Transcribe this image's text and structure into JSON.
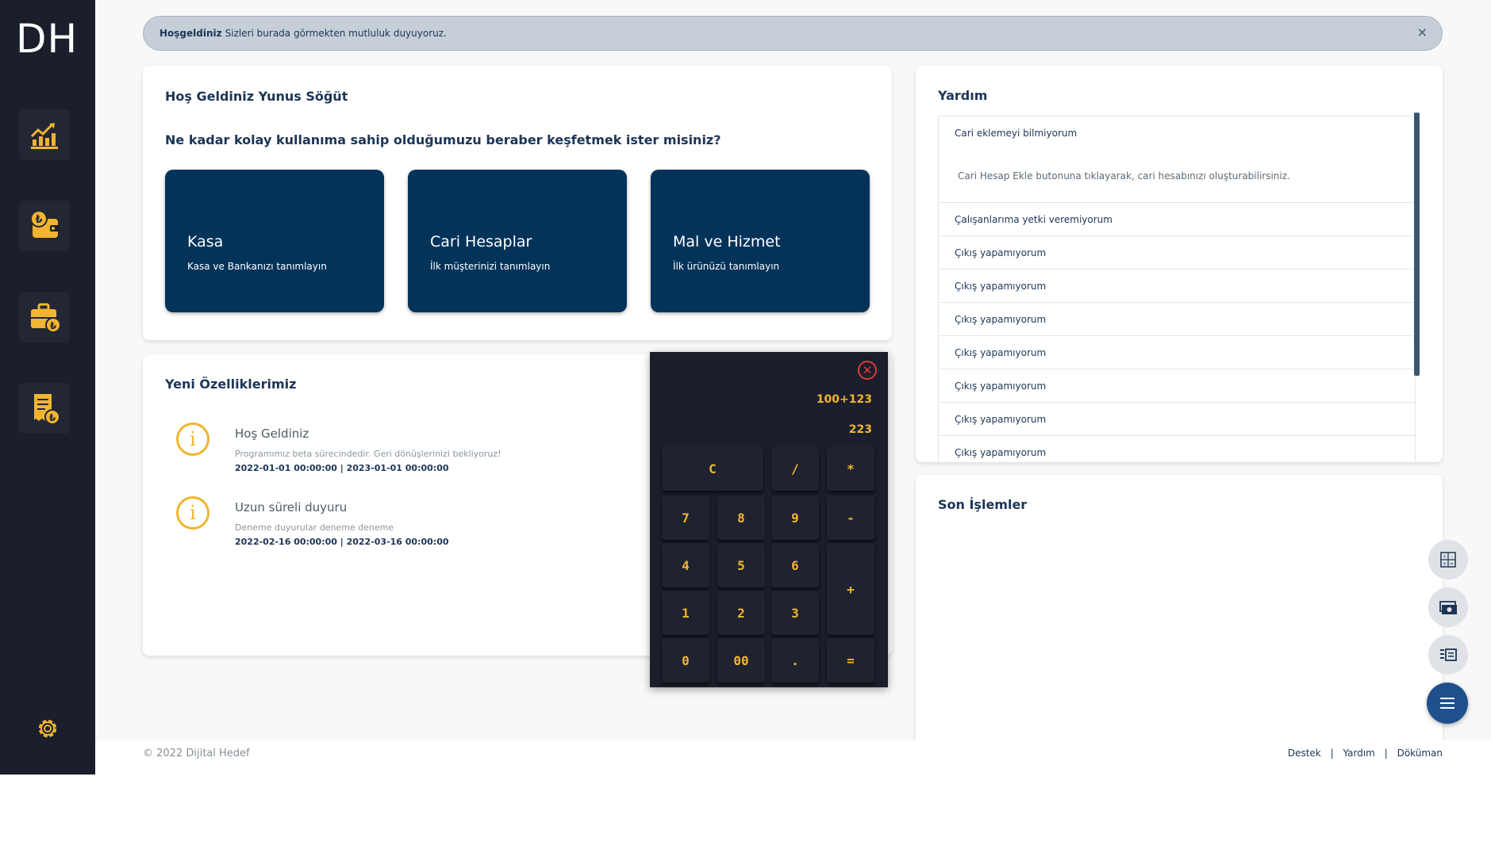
{
  "logo": "DH",
  "sidebar": {
    "items": [
      {
        "icon": "bar-chart-icon"
      },
      {
        "icon": "wallet-lira-icon"
      },
      {
        "icon": "briefcase-lira-icon"
      },
      {
        "icon": "receipt-lira-icon"
      }
    ],
    "settings_icon": "gear-icon"
  },
  "alert": {
    "strong": "Hoşgeldiniz",
    "text": "Sizleri burada görmekten mutluluk duyuyoruz.",
    "close": "×"
  },
  "welcome": {
    "title": "Hoş Geldiniz Yunus Söğüt",
    "question": "Ne kadar kolay kullanıma sahip olduğumuzu beraber keşfetmek ister misiniz?",
    "tiles": [
      {
        "title": "Kasa",
        "subtitle": "Kasa ve Bankanızı tanımlayın"
      },
      {
        "title": "Cari Hesaplar",
        "subtitle": "İlk müşterinizi tanımlayın"
      },
      {
        "title": "Mal ve Hizmet",
        "subtitle": "İlk ürünüzü tanımlayın"
      }
    ]
  },
  "features": {
    "title": "Yeni Özelliklerimiz",
    "items": [
      {
        "title": "Hoş Geldiniz",
        "desc": "Programımız beta sürecindedir. Geri dönüşlerinizi bekliyoruz!",
        "date": "2022-01-01 00:00:00 | 2023-01-01 00:00:00"
      },
      {
        "title": "Uzun süreli duyuru",
        "desc": "Deneme duyurular deneme deneme",
        "date": "2022-02-16 00:00:00 | 2022-03-16 00:00:00"
      }
    ]
  },
  "help": {
    "title": "Yardım",
    "items": [
      {
        "q": "Cari eklemeyi bilmiyorum",
        "a": "Cari Hesap Ekle butonuna tıklayarak, cari hesabınızı oluşturabilirsiniz."
      },
      {
        "q": "Çalışanlarıma yetki veremiyorum"
      },
      {
        "q": "Çıkış yapamıyorum"
      },
      {
        "q": "Çıkış yapamıyorum"
      },
      {
        "q": "Çıkış yapamıyorum"
      },
      {
        "q": "Çıkış yapamıyorum"
      },
      {
        "q": "Çıkış yapamıyorum"
      },
      {
        "q": "Çıkış yapamıyorum"
      },
      {
        "q": "Çıkış yapamıyorum"
      }
    ]
  },
  "recent": {
    "title": "Son İşlemler"
  },
  "calculator": {
    "expression": "100+123",
    "result": "223",
    "keys": [
      "C",
      "/",
      "*",
      "7",
      "8",
      "9",
      "-",
      "4",
      "5",
      "6",
      "+",
      "1",
      "2",
      "3",
      "0",
      "00",
      ".",
      "="
    ]
  },
  "fabs": [
    "calculator-icon",
    "money-icon",
    "list-icon",
    "menu-icon"
  ],
  "footer": {
    "copyright": "© 2022 Dijital Hedef",
    "links": [
      "Destek",
      "Yardım",
      "Döküman"
    ],
    "separator": "|"
  },
  "colors": {
    "sidebar": "#1b1f2b",
    "accent": "#f1b52f",
    "tile": "#04335a",
    "text": "#1c3556"
  }
}
